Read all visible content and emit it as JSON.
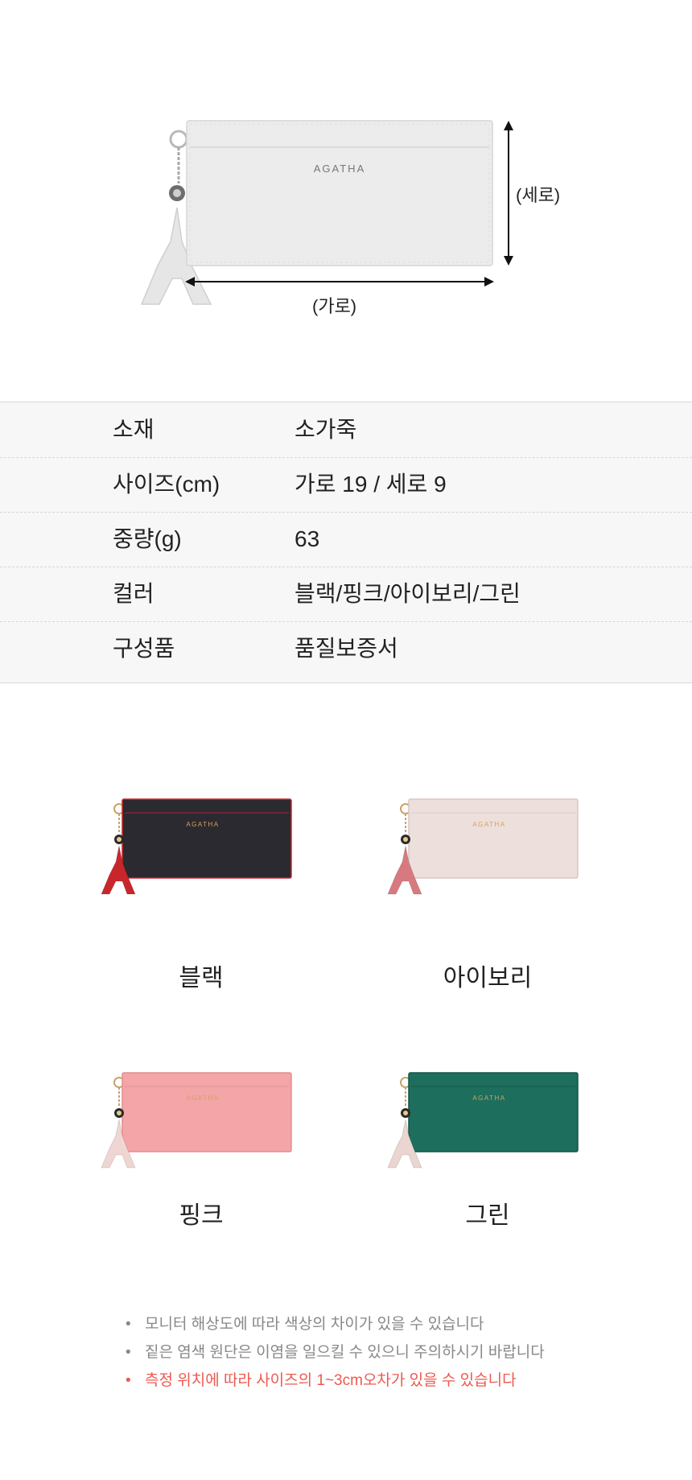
{
  "diagram": {
    "brand_label": "AGATHA",
    "height_label": "(세로)",
    "width_label": "(가로)"
  },
  "specs": [
    {
      "label": "소재",
      "value": "소가죽"
    },
    {
      "label": "사이즈(cm)",
      "value": "가로 19 / 세로 9"
    },
    {
      "label": "중량(g)",
      "value": "63"
    },
    {
      "label": "컬러",
      "value": "블랙/핑크/아이보리/그린"
    },
    {
      "label": "구성품",
      "value": "품질보증서"
    }
  ],
  "variants": [
    {
      "name": "블랙",
      "body_color": "#2b2a30",
      "edge_color": "#c9262c",
      "charm_color": "#1f1f24",
      "tassel_color": "#c9262c",
      "logo": "AGATHA"
    },
    {
      "name": "아이보리",
      "body_color": "#ecdfdc",
      "edge_color": "#d9c7c3",
      "charm_color": "#d77a80",
      "tassel_color": "#d77a80",
      "logo": "AGATHA"
    },
    {
      "name": "핑크",
      "body_color": "#f3a5a8",
      "edge_color": "#e48d92",
      "charm_color": "#f0d6d3",
      "tassel_color": "#f0d6d3",
      "logo": "AGATHA"
    },
    {
      "name": "그린",
      "body_color": "#1d6e5d",
      "edge_color": "#155547",
      "charm_color": "#ead5d0",
      "tassel_color": "#ead5d0",
      "logo": "AGATHA"
    }
  ],
  "notes": [
    {
      "text": "모니터 해상도에 따라 색상의 차이가 있을 수 있습니다",
      "highlight": false
    },
    {
      "text": "짙은 염색 원단은 이염을 일으킬 수 있으니 주의하시기 바랍니다",
      "highlight": false
    },
    {
      "text": "측정 위치에 따라 사이즈의 1~3cm오차가 있을 수 있습니다",
      "highlight": true
    }
  ],
  "colors": {
    "text": "#222222",
    "note_gray": "#888888",
    "note_red": "#ec5a4f",
    "table_bg": "#f7f7f7"
  }
}
